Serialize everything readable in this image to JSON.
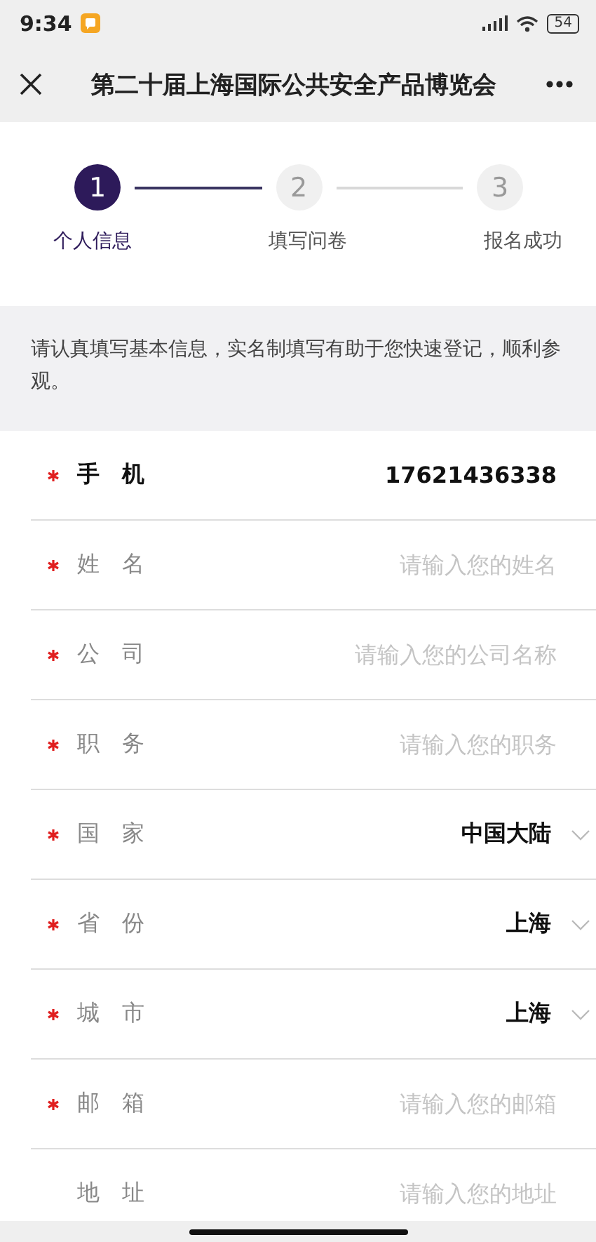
{
  "status_bar": {
    "time": "9:34",
    "battery": "54"
  },
  "header": {
    "title": "第二十届上海国际公共安全产品博览会"
  },
  "steps": [
    {
      "number": "1",
      "label": "个人信息",
      "active": true
    },
    {
      "number": "2",
      "label": "填写问卷",
      "active": false
    },
    {
      "number": "3",
      "label": "报名成功",
      "active": false
    }
  ],
  "notice": "请认真填写基本信息，实名制填写有助于您快速登记，顺利参观。",
  "fields": [
    {
      "kind": "static",
      "label": "手机",
      "required": true,
      "value": "17621436338"
    },
    {
      "kind": "input",
      "label": "姓名",
      "required": true,
      "placeholder": "请输入您的姓名"
    },
    {
      "kind": "input",
      "label": "公司",
      "required": true,
      "placeholder": "请输入您的公司名称"
    },
    {
      "kind": "input",
      "label": "职务",
      "required": true,
      "placeholder": "请输入您的职务"
    },
    {
      "kind": "select",
      "label": "国家",
      "required": true,
      "value": "中国大陆"
    },
    {
      "kind": "select",
      "label": "省份",
      "required": true,
      "value": "上海"
    },
    {
      "kind": "select",
      "label": "城市",
      "required": true,
      "value": "上海"
    },
    {
      "kind": "input",
      "label": "邮箱",
      "required": true,
      "placeholder": "请输入您的邮箱"
    },
    {
      "kind": "input",
      "label": "地址",
      "required": false,
      "placeholder": "请输入您的地址"
    }
  ]
}
